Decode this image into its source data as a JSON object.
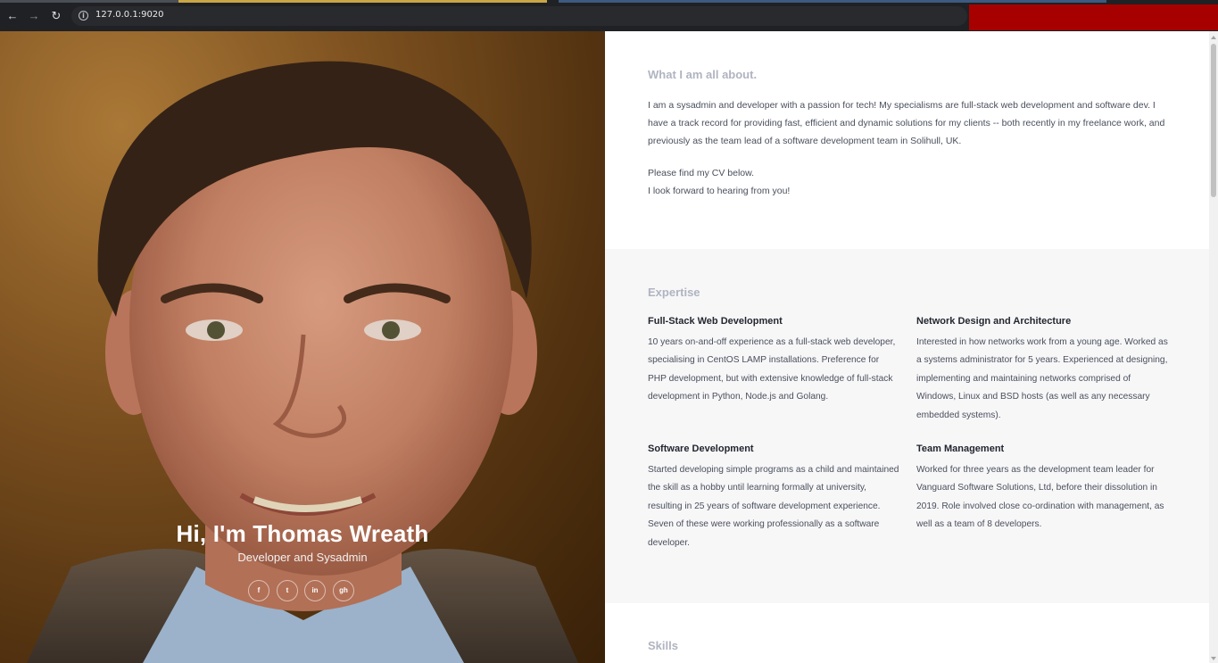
{
  "browser": {
    "url": "127.0.0.1:9020",
    "accent_extension_color": "#a70000"
  },
  "hero": {
    "name": "Hi, I'm Thomas Wreath",
    "role": "Developer and Sysadmin",
    "socials": [
      {
        "label": "f",
        "icon": "facebook-icon"
      },
      {
        "label": "t",
        "icon": "twitter-icon"
      },
      {
        "label": "in",
        "icon": "linkedin-icon"
      },
      {
        "label": "gh",
        "icon": "github-icon"
      }
    ]
  },
  "about": {
    "title": "What I am all about.",
    "paragraph1": "I am a sysadmin and developer with a passion for tech! My specialisms are full-stack web development and software dev. I have a track record for providing fast, efficient and dynamic solutions for my clients -- both recently in my freelance work, and previously as the team lead of a software development team in Solihull, UK.",
    "paragraph2_line1": "Please find my CV below.",
    "paragraph2_line2": "I look forward to hearing from you!"
  },
  "expertise": {
    "title": "Expertise",
    "items": [
      {
        "title": "Full-Stack Web Development",
        "body": "10 years on-and-off experience as a full-stack web developer, specialising in CentOS LAMP installations. Preference for PHP development, but with extensive knowledge of full-stack development in Python, Node.js and Golang."
      },
      {
        "title": "Network Design and Architecture",
        "body": "Interested in how networks work from a young age. Worked as a systems administrator for 5 years. Experienced at designing, implementing and maintaining networks comprised of Windows, Linux and BSD hosts (as well as any necessary embedded systems)."
      },
      {
        "title": "Software Development",
        "body": "Started developing simple programs as a child and maintained the skill as a hobby until learning formally at university, resulting in 25 years of software development experience. Seven of these were working professionally as a software developer."
      },
      {
        "title": "Team Management",
        "body": "Worked for three years as the development team leader for Vanguard Software Solutions, Ltd, before their dissolution in 2019. Role involved close co-ordination with management, as well as a team of 8 developers."
      }
    ]
  },
  "skills": {
    "title": "Skills"
  }
}
